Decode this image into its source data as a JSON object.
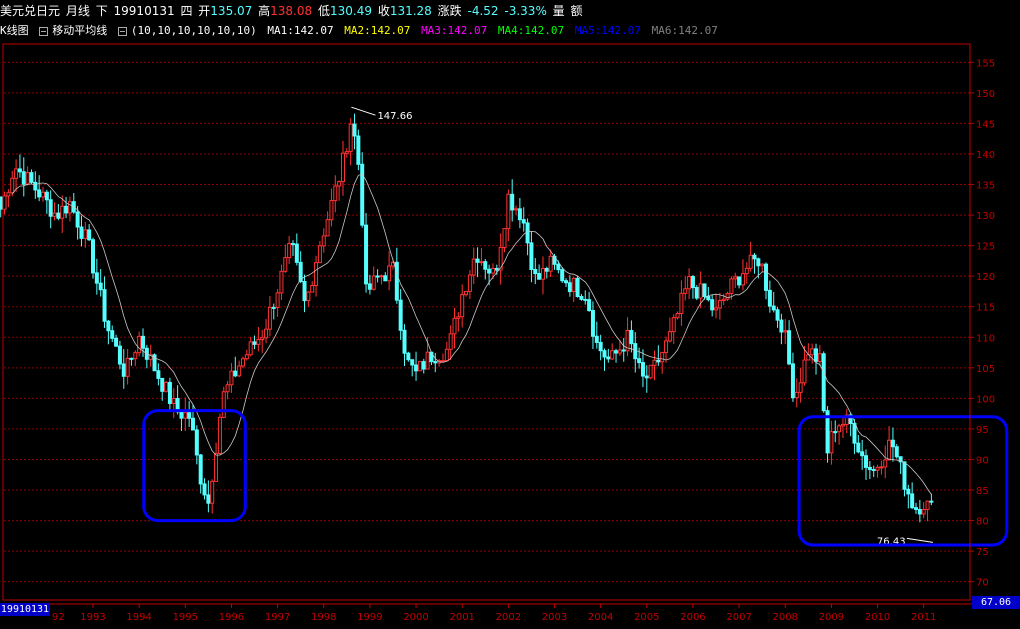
{
  "info_bar": {
    "symbol": "美元兑日元",
    "period": "月线",
    "direction": "下",
    "date": "19910131",
    "weekday": "四",
    "open_label": "开",
    "open": "135.07",
    "high_label": "高",
    "high": "138.08",
    "low_label": "低",
    "low": "130.49",
    "close_label": "收",
    "close": "131.28",
    "change_label": "涨跌",
    "change": "-4.52",
    "change_pct": "-3.33%",
    "volume_label": "量",
    "amount_label": "额"
  },
  "sub_bar": {
    "kline_label": "K线图",
    "ma_label": "移动平均线",
    "ma_params": "(10,10,10,10,10,10)",
    "ma": [
      {
        "label": "MA1:142.07",
        "color": "#ffffff"
      },
      {
        "label": "MA2:142.07",
        "color": "#ffff00"
      },
      {
        "label": "MA3:142.07",
        "color": "#ff00ff"
      },
      {
        "label": "MA4:142.07",
        "color": "#00ff00"
      },
      {
        "label": "MA5:142.07",
        "color": "#0000ff"
      },
      {
        "label": "MA6:142.07",
        "color": "#808080"
      }
    ]
  },
  "badges": {
    "cursor_date": "19910131",
    "cursor_price": "67.06"
  },
  "colors": {
    "up": "#ff3232",
    "down": "#54ffff",
    "grid": "#8b0000",
    "axis": "#c00000",
    "ma": "#c8c8c8",
    "highlight": "#0000ff"
  },
  "chart_data": {
    "type": "candlestick",
    "title": "美元兑日元 月线",
    "x_axis_labels": [
      "1993",
      "1994",
      "1995",
      "1996",
      "1997",
      "1998",
      "1999",
      "2000",
      "2001",
      "2002",
      "2003",
      "2004",
      "2005",
      "2006",
      "2007",
      "2008",
      "2009",
      "2010",
      "2011"
    ],
    "y_ticks": [
      70,
      75,
      80,
      85,
      90,
      95,
      100,
      105,
      110,
      115,
      120,
      125,
      130,
      135,
      140,
      145,
      150,
      155
    ],
    "ylim": [
      67,
      158
    ],
    "xlim": [
      1991.0,
      2011.2
    ],
    "anchors": [
      {
        "t": 1991.0,
        "p": 131
      },
      {
        "t": 1991.3,
        "p": 138
      },
      {
        "t": 1991.8,
        "p": 134
      },
      {
        "t": 1992.2,
        "p": 130
      },
      {
        "t": 1992.5,
        "p": 132
      },
      {
        "t": 1992.9,
        "p": 125
      },
      {
        "t": 1993.3,
        "p": 112
      },
      {
        "t": 1993.7,
        "p": 104
      },
      {
        "t": 1994.0,
        "p": 110
      },
      {
        "t": 1994.4,
        "p": 104
      },
      {
        "t": 1994.8,
        "p": 98
      },
      {
        "t": 1995.1,
        "p": 97
      },
      {
        "t": 1995.3,
        "p": 88
      },
      {
        "t": 1995.5,
        "p": 83
      },
      {
        "t": 1995.8,
        "p": 100
      },
      {
        "t": 1996.2,
        "p": 106
      },
      {
        "t": 1996.7,
        "p": 111
      },
      {
        "t": 1997.0,
        "p": 118
      },
      {
        "t": 1997.3,
        "p": 125
      },
      {
        "t": 1997.6,
        "p": 115
      },
      {
        "t": 1997.9,
        "p": 125
      },
      {
        "t": 1998.1,
        "p": 130
      },
      {
        "t": 1998.4,
        "p": 138
      },
      {
        "t": 1998.6,
        "p": 146
      },
      {
        "t": 1998.8,
        "p": 136
      },
      {
        "t": 1998.9,
        "p": 117
      },
      {
        "t": 1999.2,
        "p": 120
      },
      {
        "t": 1999.5,
        "p": 121
      },
      {
        "t": 1999.8,
        "p": 106
      },
      {
        "t": 2000.0,
        "p": 104
      },
      {
        "t": 2000.3,
        "p": 107
      },
      {
        "t": 2000.7,
        "p": 108
      },
      {
        "t": 2001.0,
        "p": 117
      },
      {
        "t": 2001.3,
        "p": 124
      },
      {
        "t": 2001.7,
        "p": 120
      },
      {
        "t": 2002.0,
        "p": 133
      },
      {
        "t": 2002.3,
        "p": 130
      },
      {
        "t": 2002.6,
        "p": 119
      },
      {
        "t": 2002.9,
        "p": 122
      },
      {
        "t": 2003.3,
        "p": 119
      },
      {
        "t": 2003.7,
        "p": 117
      },
      {
        "t": 2003.9,
        "p": 109
      },
      {
        "t": 2004.2,
        "p": 106
      },
      {
        "t": 2004.6,
        "p": 110
      },
      {
        "t": 2004.9,
        "p": 103
      },
      {
        "t": 2005.1,
        "p": 104
      },
      {
        "t": 2005.5,
        "p": 110
      },
      {
        "t": 2005.9,
        "p": 119
      },
      {
        "t": 2006.2,
        "p": 117
      },
      {
        "t": 2006.5,
        "p": 114
      },
      {
        "t": 2006.8,
        "p": 118
      },
      {
        "t": 2007.1,
        "p": 121
      },
      {
        "t": 2007.45,
        "p": 123
      },
      {
        "t": 2007.7,
        "p": 115
      },
      {
        "t": 2007.95,
        "p": 112
      },
      {
        "t": 2008.2,
        "p": 100
      },
      {
        "t": 2008.5,
        "p": 108
      },
      {
        "t": 2008.75,
        "p": 106
      },
      {
        "t": 2008.9,
        "p": 91
      },
      {
        "t": 2009.1,
        "p": 96
      },
      {
        "t": 2009.4,
        "p": 96
      },
      {
        "t": 2009.7,
        "p": 90
      },
      {
        "t": 2009.9,
        "p": 88
      },
      {
        "t": 2010.3,
        "p": 93
      },
      {
        "t": 2010.6,
        "p": 86
      },
      {
        "t": 2010.8,
        "p": 82
      },
      {
        "t": 2011.0,
        "p": 83
      },
      {
        "t": 2011.15,
        "p": 82
      }
    ],
    "annotations": [
      {
        "label": "147.66",
        "t": 1998.6,
        "p": 147.66,
        "type": "high"
      },
      {
        "label": "76.43",
        "t": 2011.2,
        "p": 76.43,
        "type": "low"
      }
    ],
    "highlight_regions": [
      {
        "t0": 1994.1,
        "t1": 1996.3,
        "p0": 80,
        "p1": 98
      },
      {
        "t0": 2008.3,
        "t1": 2012.8,
        "p0": 76,
        "p1": 97
      }
    ],
    "x_hidden_first_label": "92"
  }
}
